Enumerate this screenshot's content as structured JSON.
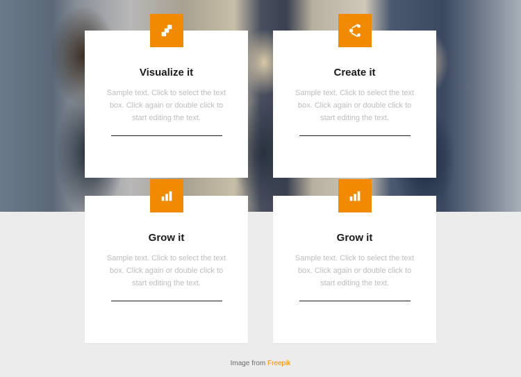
{
  "colors": {
    "accent": "#f18a00"
  },
  "cards": [
    {
      "icon": "layers-icon",
      "title": "Visualize it",
      "desc": "Sample text. Click to select the text box. Click again or double click to start editing the text."
    },
    {
      "icon": "share-icon",
      "title": "Create it",
      "desc": "Sample text. Click to select the text box. Click again or double click to start editing the text."
    },
    {
      "icon": "bars-icon",
      "title": "Grow it",
      "desc": "Sample text. Click to select the text box. Click again or double click to start editing the text."
    },
    {
      "icon": "bars-icon",
      "title": "Grow it",
      "desc": "Sample text. Click to select the text box. Click again or double click to start editing the text."
    }
  ],
  "credit": {
    "prefix": "Image from ",
    "link_text": "Freepik"
  }
}
